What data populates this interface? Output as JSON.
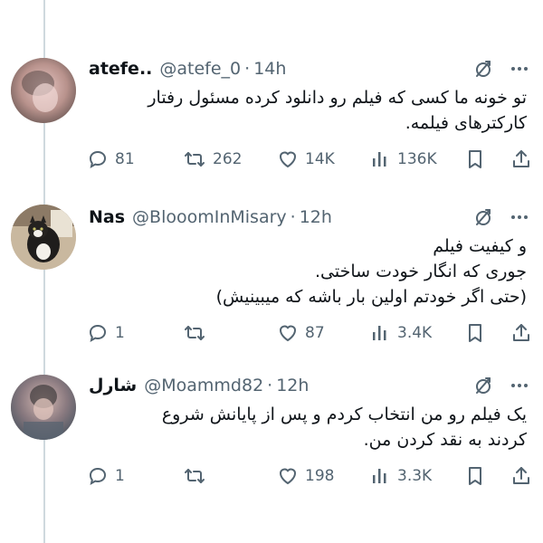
{
  "tweets": [
    {
      "name": "atefe..",
      "handle": "@atefe_0",
      "separator": "·",
      "time": "14h",
      "lines": [
        "تو خونه ما کسی که فیلم رو دانلود کرده مسئول رفتار",
        "کارکترهای فیلمه."
      ],
      "replies": "81",
      "retweets": "262",
      "likes": "14K",
      "views": "136K"
    },
    {
      "name": "Nas",
      "handle": "@BlooomInMisary",
      "separator": "·",
      "time": "12h",
      "lines": [
        "و کیفیت فیلم",
        "جوری که انگار خودت ساختی.",
        "(حتی اگر خودتم اولین بار باشه که میبینیش)"
      ],
      "replies": "1",
      "retweets": "",
      "likes": "87",
      "views": "3.4K"
    },
    {
      "name": "شارل",
      "handle": "@Moammd82",
      "separator": "·",
      "time": "12h",
      "lines": [
        "یک فیلم رو من انتخاب کردم و پس از پایانش شروع",
        "کردند به نقد کردن من."
      ],
      "replies": "1",
      "retweets": "",
      "likes": "198",
      "views": "3.3K"
    }
  ],
  "colors": {
    "text": "#0f1419",
    "secondary": "#536471",
    "thread_line": "#cfd9de"
  },
  "icons": [
    "mute-icon",
    "more-icon",
    "reply-icon",
    "retweet-icon",
    "like-icon",
    "views-icon",
    "bookmark-icon",
    "share-icon"
  ]
}
